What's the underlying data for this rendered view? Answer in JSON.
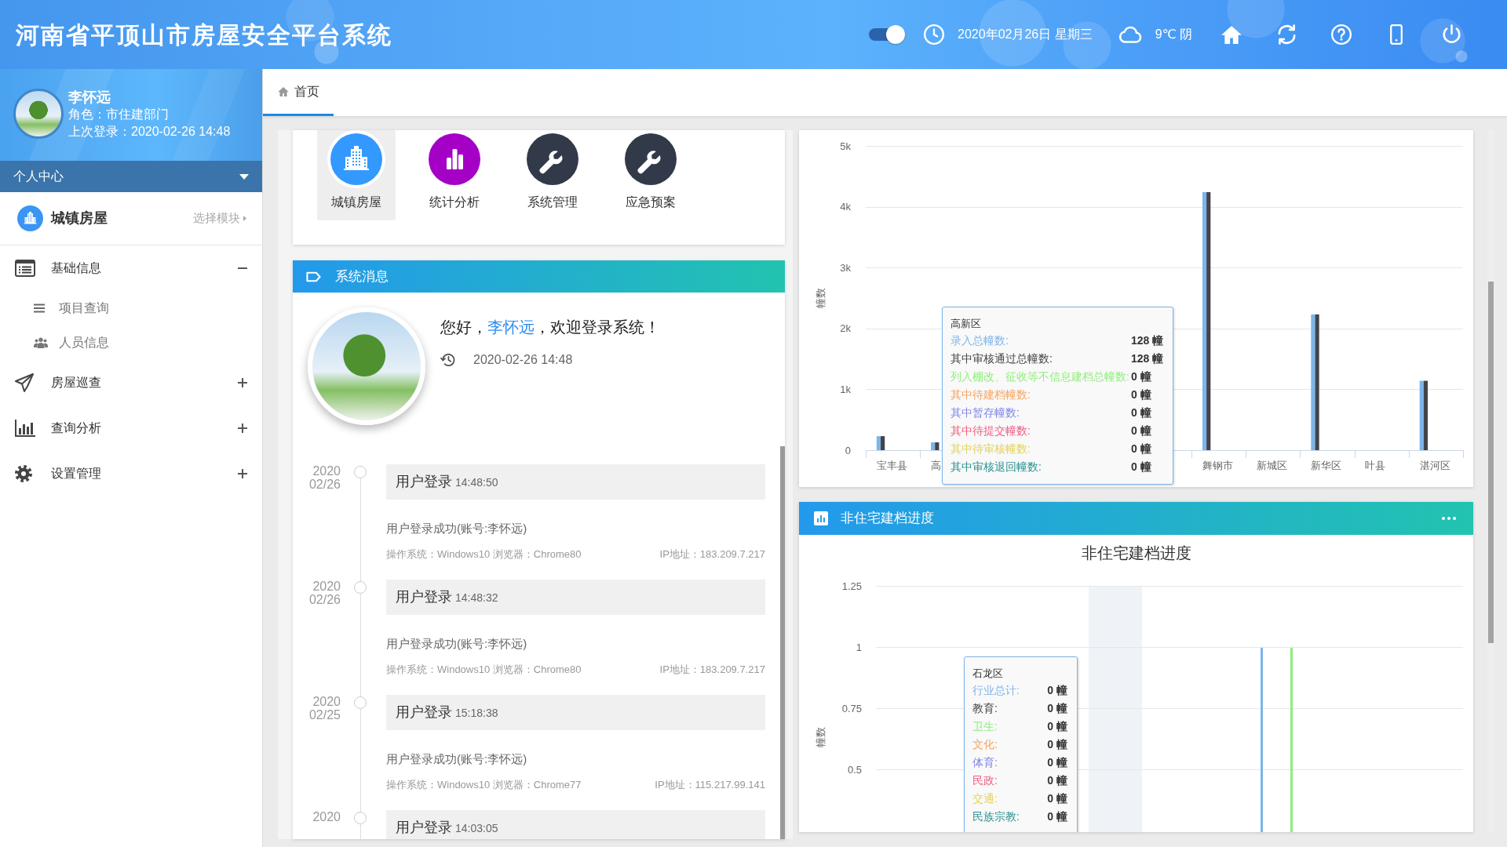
{
  "header": {
    "title": "河南省平顶山市房屋安全平台系统",
    "toggle": {
      "on": true
    },
    "date": "2020年02月26日 星期三",
    "weather": "9℃ 阴",
    "tools": [
      {
        "kind": "home"
      },
      {
        "kind": "refresh"
      },
      {
        "kind": "help"
      },
      {
        "kind": "mobile"
      },
      {
        "kind": "power"
      }
    ]
  },
  "sidebar": {
    "user": {
      "name": "李怀远",
      "role": "角色：市住建部门",
      "last_login": "上次登录：2020-02-26 14:48"
    },
    "personal_center": "个人中心",
    "module": {
      "name": "城镇房屋",
      "switch_label": "选择模块"
    },
    "menu": [
      {
        "kind": "list",
        "label": "基础信息",
        "expanded": true,
        "children": [
          {
            "kind": "lines",
            "label": "项目查询"
          },
          {
            "kind": "users",
            "label": "人员信息"
          }
        ]
      },
      {
        "kind": "plane",
        "label": "房屋巡查",
        "expanded": false
      },
      {
        "kind": "chart",
        "label": "查询分析",
        "expanded": false
      },
      {
        "kind": "gear",
        "label": "设置管理",
        "expanded": false
      }
    ]
  },
  "tabs": [
    {
      "label": "首页",
      "selected": true
    }
  ],
  "modules": [
    {
      "kind": "building",
      "label": "城镇房屋",
      "color": "#3399ff",
      "selected": true
    },
    {
      "kind": "chart",
      "label": "统计分析",
      "color": "#a501c6",
      "selected": false
    },
    {
      "kind": "wrench",
      "label": "系统管理",
      "color": "#323948",
      "selected": false
    },
    {
      "kind": "wrench",
      "label": "应急预案",
      "color": "#323948",
      "selected": false
    }
  ],
  "messages": {
    "title": "系统消息",
    "greeting": {
      "before": "您好，",
      "user": "李怀远",
      "after": "，欢迎登录系统！"
    },
    "login_time": "2020-02-26 14:48",
    "timeline": [
      {
        "year": "2020",
        "day": "02/26",
        "title": "用户登录",
        "time": "14:48:50",
        "detail": "用户登录成功(账号:李怀远)",
        "client": "操作系统：Windows10 浏览器：Chrome80",
        "ip": "IP地址：183.209.7.217"
      },
      {
        "year": "2020",
        "day": "02/26",
        "title": "用户登录",
        "time": "14:48:32",
        "detail": "用户登录成功(账号:李怀远)",
        "client": "操作系统：Windows10 浏览器：Chrome80",
        "ip": "IP地址：183.209.7.217"
      },
      {
        "year": "2020",
        "day": "02/25",
        "title": "用户登录",
        "time": "15:18:38",
        "detail": "用户登录成功(账号:李怀远)",
        "client": "操作系统：Windows10 浏览器：Chrome77",
        "ip": "IP地址：115.217.99.141"
      },
      {
        "year": "2020",
        "title": "用户登录",
        "time": "14:03:05"
      }
    ]
  },
  "building_chart": {
    "chart_data": {
      "type": "bar",
      "ylabel": "幢数",
      "grid": true,
      "categories": [
        "宝丰县",
        "高",
        null,
        null,
        null,
        null,
        "舞钢市",
        "新城区",
        "新华区",
        "叶县",
        "湛河区"
      ],
      "series": [
        {
          "color": "#7cb5ec",
          "values": [
            230,
            128,
            null,
            null,
            null,
            null,
            4240,
            0,
            2230,
            0,
            1140
          ]
        },
        {
          "color": "#434348",
          "values": [
            230,
            128,
            null,
            null,
            null,
            null,
            4240,
            0,
            2230,
            0,
            1140
          ]
        },
        {
          "color": "#90ed7d",
          "values": [
            0,
            0,
            null,
            null,
            null,
            null,
            0,
            0,
            0,
            0,
            0
          ]
        },
        {
          "color": "#f7a35c",
          "values": [
            0,
            0,
            null,
            null,
            null,
            null,
            0,
            0,
            0,
            0,
            0
          ]
        },
        {
          "color": "#8085e9",
          "values": [
            0,
            0,
            null,
            null,
            null,
            null,
            0,
            0,
            0,
            0,
            0
          ]
        },
        {
          "color": "#f15c80",
          "values": [
            0,
            0,
            null,
            null,
            null,
            null,
            0,
            0,
            0,
            0,
            0
          ]
        },
        {
          "color": "#e4d354",
          "values": [
            0,
            0,
            null,
            null,
            null,
            null,
            0,
            0,
            0,
            0,
            0
          ]
        },
        {
          "color": "#2b908f",
          "values": [
            0,
            0,
            null,
            null,
            null,
            null,
            0,
            0,
            0,
            0,
            0
          ]
        }
      ],
      "ylim": [
        0,
        5000
      ],
      "yticks": [
        {
          "value": 0,
          "label": "0"
        },
        {
          "value": 1000,
          "label": "1k"
        },
        {
          "value": 2000,
          "label": "2k"
        },
        {
          "value": 3000,
          "label": "3k"
        },
        {
          "value": 4000,
          "label": "4k"
        },
        {
          "value": 5000,
          "label": "5k"
        }
      ]
    },
    "tooltip": {
      "title": "高新区",
      "rows": [
        {
          "label": "录入总幢数:",
          "value": "128 幢"
        },
        {
          "label": "其中审核通过总幢数:",
          "value": "128 幢"
        },
        {
          "label": "列入棚改、征收等不信息建档总幢数:",
          "value": "0 幢"
        },
        {
          "label": "其中待建档幢数:",
          "value": "0 幢"
        },
        {
          "label": "其中暂存幢数:",
          "value": "0 幢"
        },
        {
          "label": "其中待提交幢数:",
          "value": "0 幢"
        },
        {
          "label": "其中待审核幢数:",
          "value": "0 幢"
        },
        {
          "label": "其中审核退回幢数:",
          "value": "0 幢"
        }
      ]
    }
  },
  "progress_panel": {
    "title": "非住宅建档进度",
    "chart": {
      "title": "非住宅建档进度",
      "ylabel": "幢数",
      "ytick_labels": [
        "1.25",
        "1",
        "0.75",
        "0.5"
      ]
    },
    "tooltip": {
      "title": "石龙区",
      "rows": [
        {
          "label": "行业总计:",
          "value": "0 幢",
          "color": "#7cb5ec"
        },
        {
          "label": "教育:",
          "value": "0 幢",
          "color": "#434348"
        },
        {
          "label": "卫生:",
          "value": "0 幢",
          "color": "#90ed7d"
        },
        {
          "label": "文化:",
          "value": "0 幢",
          "color": "#f7a35c"
        },
        {
          "label": "体育:",
          "value": "0 幢",
          "color": "#8085e9"
        },
        {
          "label": "民政:",
          "value": "0 幢",
          "color": "#f15c80"
        },
        {
          "label": "交通:",
          "value": "0 幢",
          "color": "#e4d354"
        },
        {
          "label": "民族宗教:",
          "value": "0 幢",
          "color": "#2b908f"
        }
      ]
    }
  }
}
